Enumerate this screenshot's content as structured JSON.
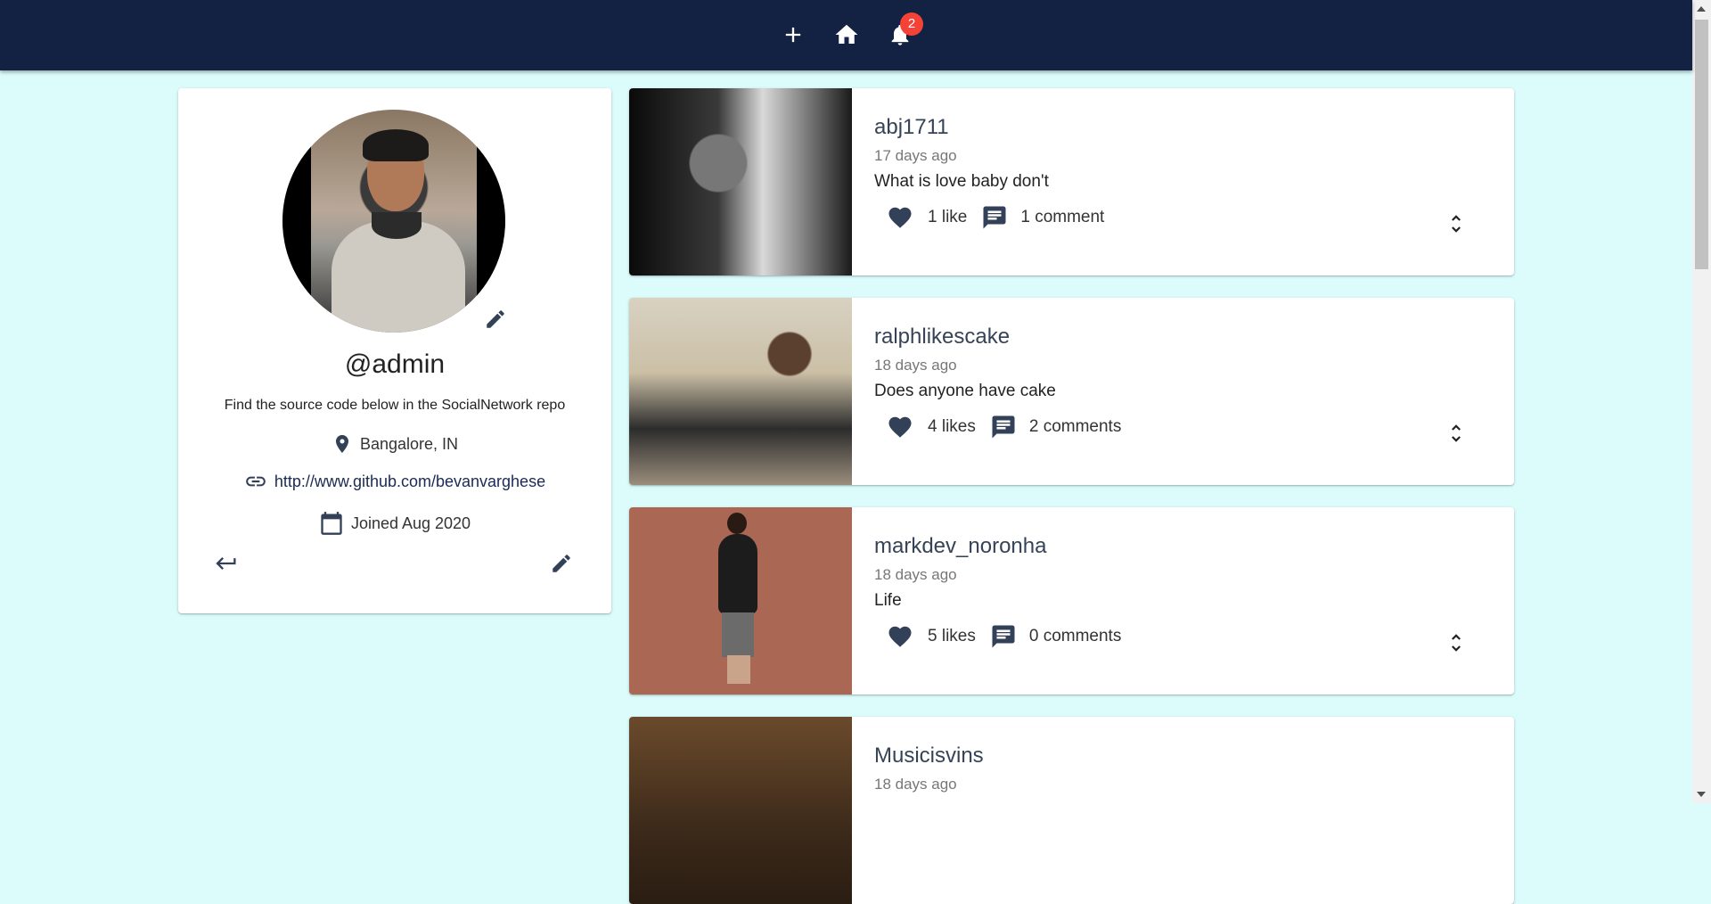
{
  "appbar": {
    "notification_count": "2",
    "icons": [
      "add-icon",
      "home-icon",
      "bell-icon"
    ],
    "background": "#132142"
  },
  "profile": {
    "handle": "@admin",
    "bio": "Find the source code below in the SocialNetwork repo",
    "location": "Bangalore, IN",
    "website": "http://www.github.com/bevanvarghese",
    "joined": "Joined Aug 2020"
  },
  "posts": [
    {
      "username": "abj1711",
      "time": "17 days ago",
      "body": "What is love baby don't",
      "likes": "1 like",
      "comments": "1 comment"
    },
    {
      "username": "ralphlikescake",
      "time": "18 days ago",
      "body": "Does anyone have cake",
      "likes": "4 likes",
      "comments": "2 comments"
    },
    {
      "username": "markdev_noronha",
      "time": "18 days ago",
      "body": "Life",
      "likes": "5 likes",
      "comments": "0 comments"
    },
    {
      "username": "Musicisvins",
      "time": "18 days ago"
    }
  ],
  "colors": {
    "page_background": "#dcfcfc",
    "icon_color": "#324058",
    "badge": "#f44336"
  }
}
